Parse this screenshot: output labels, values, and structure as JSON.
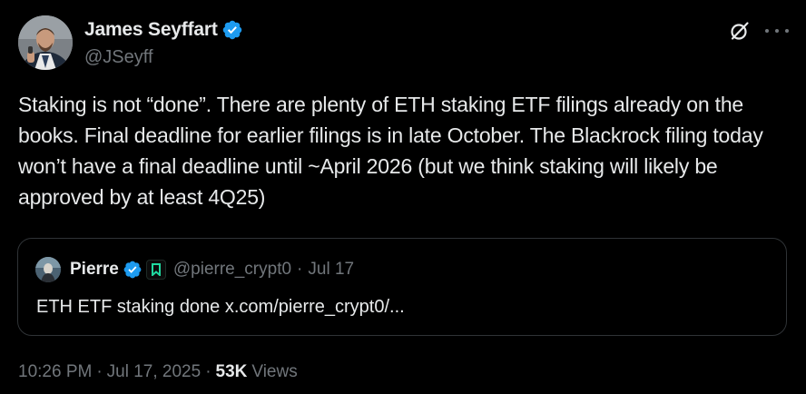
{
  "author": {
    "display_name": "James Seyffart",
    "handle": "@JSeyff",
    "verified": true
  },
  "tweet": {
    "text": "Staking is not “done”. There are plenty of ETH staking ETF filings already on the books. Final deadline for earlier filings is in late October. The Blackrock filing today won’t have a final deadline until ~April 2026 (but we think staking will likely be approved by at least 4Q25)"
  },
  "quoted_tweet": {
    "display_name": "Pierre",
    "handle": "@pierre_crypt0",
    "separator": "·",
    "date": "Jul 17",
    "text": "ETH ETF staking done x.com/pierre_crypt0/..."
  },
  "meta": {
    "time": "10:26 PM",
    "separator": "·",
    "date": "Jul 17, 2025",
    "views_count": "53K",
    "views_label": "Views"
  },
  "icons": {
    "grok": "grok-icon",
    "more": "more-icon",
    "verified": "verified-badge-icon",
    "affiliate": "bookmark-badge-icon"
  },
  "colors": {
    "background": "#000000",
    "primary_text": "#e7e9ea",
    "secondary_text": "#71767b",
    "verified_blue": "#1d9bf0",
    "border": "#2f3336",
    "affiliate_green": "#20d9a0"
  }
}
